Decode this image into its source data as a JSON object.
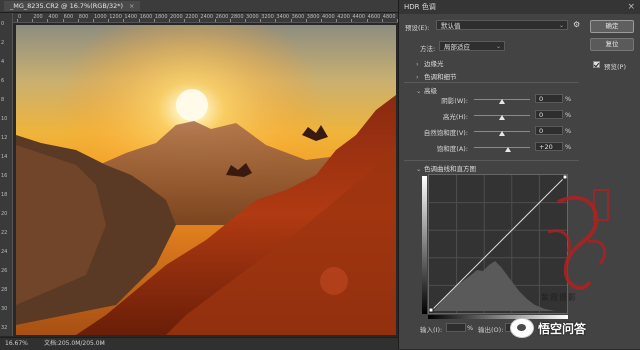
{
  "document": {
    "tab_title": "_MG_8235.CR2 @ 16.7%(RGB/32*)",
    "close_symbol": "×",
    "zoom": "16.67%",
    "doc_info": "文档:205.0M/205.0M",
    "status_arrow": ">"
  },
  "ruler": {
    "h_ticks": [
      "0",
      "200",
      "400",
      "600",
      "800",
      "1000",
      "1200",
      "1400",
      "1600",
      "1800",
      "2000",
      "2200",
      "2400",
      "2600",
      "2800",
      "3000",
      "3200",
      "3400",
      "3600",
      "3800",
      "4000",
      "4200",
      "4400",
      "4600",
      "4800",
      "5000"
    ],
    "v_ticks": [
      "0",
      "2",
      "4",
      "6",
      "8",
      "10",
      "12",
      "14",
      "16",
      "18",
      "20",
      "22",
      "24",
      "26",
      "28",
      "30",
      "32"
    ]
  },
  "dialog": {
    "title": "HDR 色调",
    "close": "×",
    "preset_label": "预设(E):",
    "preset_value": "默认值",
    "ok": "确定",
    "cancel": "复位",
    "preview_label": "预览(P)",
    "preview_checked": true,
    "method_label": "方法:",
    "method_value": "局部适应",
    "sections": {
      "edge_glow": "边缘光",
      "tone_detail": "色调和细节",
      "advanced": "高级",
      "curve": "色调曲线和直方图"
    },
    "sliders": [
      {
        "label": "阴影(W):",
        "value": "0",
        "unit": "%",
        "level": 0.5
      },
      {
        "label": "高光(H):",
        "value": "0",
        "unit": "%",
        "level": 0.5
      },
      {
        "label": "自然饱和度(V):",
        "value": "0",
        "unit": "%",
        "level": 0.5
      },
      {
        "label": "饱和度(A):",
        "value": "+20",
        "unit": "%",
        "level": 0.6
      }
    ],
    "curve_input_label": "输入(I):",
    "curve_output_label": "输出(O):",
    "curve_unit": "%"
  },
  "watermark": {
    "seal_text": "紫霞摄影",
    "brand_text": "悟空问答"
  },
  "colors": {
    "accent_red": "#b02020"
  }
}
